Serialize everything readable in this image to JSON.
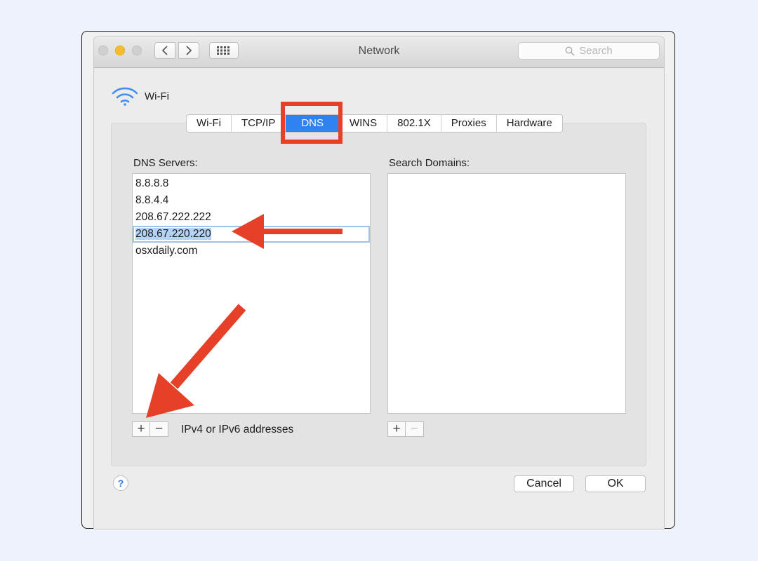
{
  "window": {
    "title": "Network",
    "search_placeholder": "Search"
  },
  "network": {
    "interface_name": "Wi-Fi"
  },
  "tabs": [
    "Wi-Fi",
    "TCP/IP",
    "DNS",
    "WINS",
    "802.1X",
    "Proxies",
    "Hardware"
  ],
  "active_tab": "DNS",
  "dns": {
    "servers_label": "DNS Servers:",
    "servers": [
      "8.8.8.8",
      "8.8.4.4",
      "208.67.222.222",
      "208.67.220.220",
      "osxdaily.com"
    ],
    "selected_server": "208.67.220.220",
    "domains_label": "Search Domains:",
    "domains": [],
    "hint": "IPv4 or IPv6 addresses"
  },
  "controls": {
    "plus": "+",
    "minus": "−",
    "help": "?",
    "cancel": "Cancel",
    "ok": "OK"
  },
  "colors": {
    "accent": "#2e83f0",
    "highlight": "#e64128",
    "traffic_yellow": "#f6bd30"
  },
  "icons": [
    "wifi-icon",
    "back-icon",
    "forward-icon",
    "grid-icon",
    "search-icon"
  ]
}
